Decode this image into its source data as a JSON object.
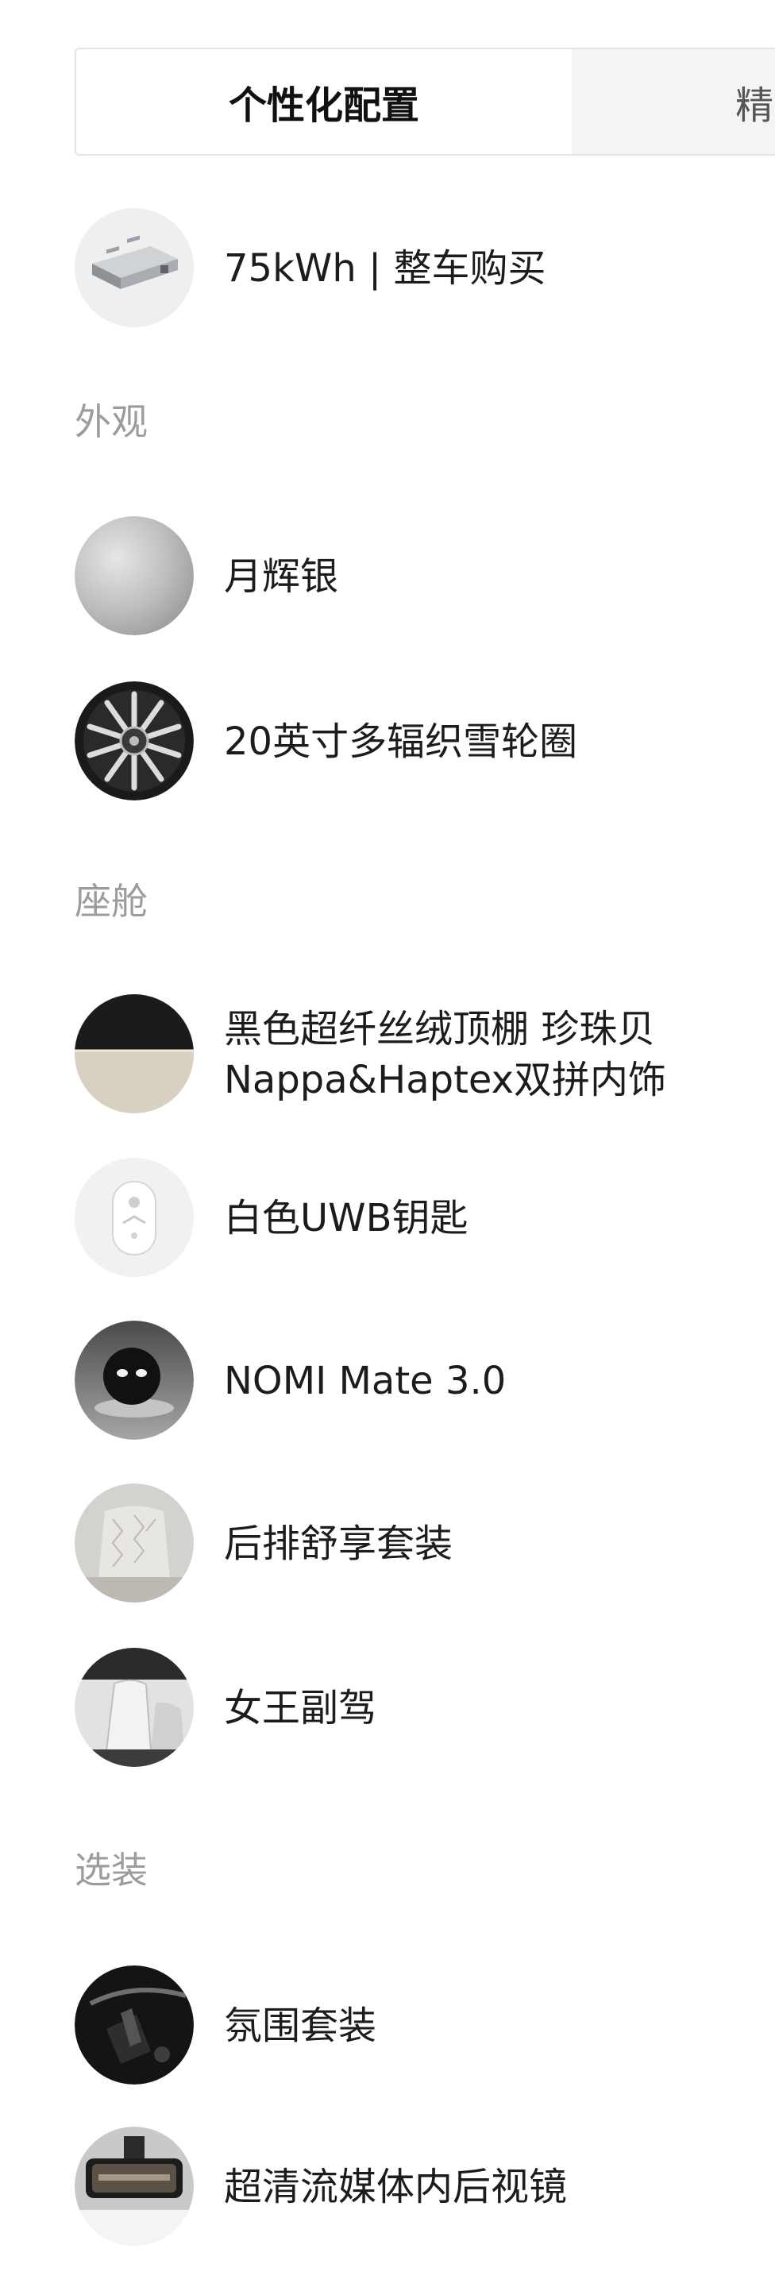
{
  "tabs": {
    "active_label": "个性化配置",
    "inactive_label": "精"
  },
  "battery": {
    "label": "75kWh | 整车购买",
    "icon": "battery-pack-icon"
  },
  "sections": {
    "exterior": {
      "title": "外观",
      "items": [
        {
          "label": "月辉银",
          "icon": "silver-paint-swatch"
        },
        {
          "label": "20英寸多辐织雪轮圈",
          "icon": "wheel-rim-icon"
        }
      ]
    },
    "cabin": {
      "title": "座舱",
      "items": [
        {
          "label": "黑色超纤丝绒顶棚 珍珠贝\nNappa&Haptex双拼内饰",
          "icon": "interior-fabric-swatch"
        },
        {
          "label": "白色UWB钥匙",
          "icon": "uwb-key-icon"
        },
        {
          "label": "NOMI Mate 3.0",
          "icon": "nomi-robot-icon"
        },
        {
          "label": "后排舒享套装",
          "icon": "rear-seat-icon"
        },
        {
          "label": "女王副驾",
          "icon": "passenger-seat-icon"
        }
      ]
    },
    "options": {
      "title": "选装",
      "items": [
        {
          "label": "氛围套装",
          "icon": "ambient-light-icon"
        },
        {
          "label": "超清流媒体内后视镜",
          "icon": "rearview-mirror-icon"
        }
      ]
    }
  },
  "colors": {
    "section_title": "#9c9c9c",
    "text": "#1c1c1c",
    "tab_border": "#e4e4e4",
    "tab_inactive_bg": "#f4f4f4"
  }
}
